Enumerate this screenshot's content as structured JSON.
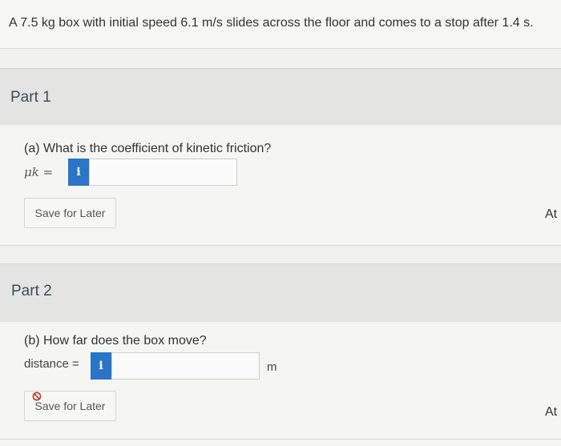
{
  "problem": {
    "text": "A 7.5 kg box with initial speed 6.1 m/s slides across the floor and comes to a stop after 1.4 s."
  },
  "part1": {
    "title": "Part 1",
    "question": "(a) What is the coefficient of kinetic friction?",
    "answer_label": "μk =",
    "info_label": "i",
    "input_value": "",
    "save_label": "Save for Later",
    "attempts_label": "At"
  },
  "part2": {
    "title": "Part 2",
    "question": "(b) How far does the box move?",
    "answer_label": "distance =",
    "info_label": "i",
    "input_value": "",
    "unit": "m",
    "save_label": "Save for Later",
    "attempts_label": "At"
  },
  "colors": {
    "info_button": "#2a75c8",
    "blocked_icon": "#c0392b"
  }
}
